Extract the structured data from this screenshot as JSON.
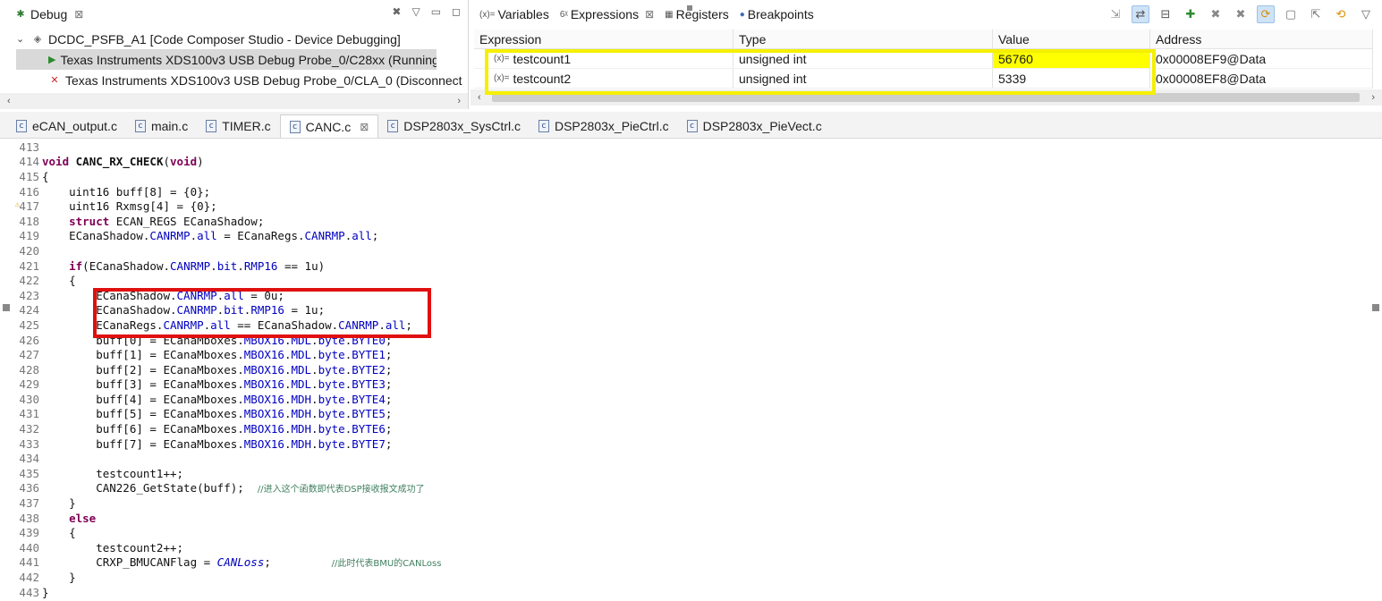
{
  "debug_view": {
    "tab_label": "Debug",
    "tree": [
      {
        "label": "DCDC_PSFB_A1 [Code Composer Studio - Device Debugging]",
        "level": 0
      },
      {
        "label": "Texas Instruments XDS100v3 USB Debug Probe_0/C28xx (Running)",
        "level": 1,
        "selected": true
      },
      {
        "label": "Texas Instruments XDS100v3 USB Debug Probe_0/CLA_0 (Disconnect",
        "level": 1
      }
    ]
  },
  "expressions_view": {
    "tabs": [
      "Variables",
      "Expressions",
      "Registers",
      "Breakpoints"
    ],
    "active_tab": "Expressions",
    "columns": [
      "Expression",
      "Type",
      "Value",
      "Address"
    ],
    "rows": [
      {
        "expression": "testcount1",
        "type": "unsigned int",
        "value": "56760",
        "address": "0x00008EF9@Data",
        "highlight": true
      },
      {
        "expression": "testcount2",
        "type": "unsigned int",
        "value": "5339",
        "address": "0x00008EF8@Data",
        "highlight": false
      }
    ]
  },
  "editor_tabs": [
    {
      "label": "eCAN_output.c"
    },
    {
      "label": "main.c"
    },
    {
      "label": "TIMER.c"
    },
    {
      "label": "CANC.c",
      "active": true
    },
    {
      "label": "DSP2803x_SysCtrl.c"
    },
    {
      "label": "DSP2803x_PieCtrl.c"
    },
    {
      "label": "DSP2803x_PieVect.c"
    }
  ],
  "code_lines": [
    {
      "n": "413",
      "html": ""
    },
    {
      "n": "414",
      "html": "<span class='kw'>void</span> <b>CANC_RX_CHECK</b>(<span class='kw'>void</span>)"
    },
    {
      "n": "415",
      "html": "{"
    },
    {
      "n": "416",
      "html": "    uint16 buff[8] = {0};"
    },
    {
      "n": "417",
      "html": "    uint16 Rxmsg[4] = {0};",
      "warn": true
    },
    {
      "n": "418",
      "html": "    <span class='kw'>struct</span> ECAN_REGS ECanaShadow;"
    },
    {
      "n": "419",
      "html": "    ECanaShadow.<span class='fld'>CANRMP</span>.<span class='fld'>all</span> = ECanaRegs.<span class='fld'>CANRMP</span>.<span class='fld'>all</span>;"
    },
    {
      "n": "420",
      "html": ""
    },
    {
      "n": "421",
      "html": "    <span class='kw'>if</span>(ECanaShadow.<span class='fld'>CANRMP</span>.<span class='fld'>bit</span>.<span class='fld'>RMP16</span> == 1u)"
    },
    {
      "n": "422",
      "html": "    {"
    },
    {
      "n": "423",
      "html": "        ECanaShadow.<span class='fld'>CANRMP</span>.<span class='fld'>all</span> = 0u;"
    },
    {
      "n": "424",
      "html": "        ECanaShadow.<span class='fld'>CANRMP</span>.<span class='fld'>bit</span>.<span class='fld'>RMP16</span> = 1u;"
    },
    {
      "n": "425",
      "html": "        ECanaRegs.<span class='fld'>CANRMP</span>.<span class='fld'>all</span> == ECanaShadow.<span class='fld'>CANRMP</span>.<span class='fld'>all</span>;"
    },
    {
      "n": "426",
      "html": "        buff[0] = ECanaMboxes.<span class='fld'>MBOX16</span>.<span class='fld'>MDL</span>.<span class='fld'>byte</span>.<span class='fld'>BYTE0</span>;"
    },
    {
      "n": "427",
      "html": "        buff[1] = ECanaMboxes.<span class='fld'>MBOX16</span>.<span class='fld'>MDL</span>.<span class='fld'>byte</span>.<span class='fld'>BYTE1</span>;"
    },
    {
      "n": "428",
      "html": "        buff[2] = ECanaMboxes.<span class='fld'>MBOX16</span>.<span class='fld'>MDL</span>.<span class='fld'>byte</span>.<span class='fld'>BYTE2</span>;"
    },
    {
      "n": "429",
      "html": "        buff[3] = ECanaMboxes.<span class='fld'>MBOX16</span>.<span class='fld'>MDL</span>.<span class='fld'>byte</span>.<span class='fld'>BYTE3</span>;"
    },
    {
      "n": "430",
      "html": "        buff[4] = ECanaMboxes.<span class='fld'>MBOX16</span>.<span class='fld'>MDH</span>.<span class='fld'>byte</span>.<span class='fld'>BYTE4</span>;"
    },
    {
      "n": "431",
      "html": "        buff[5] = ECanaMboxes.<span class='fld'>MBOX16</span>.<span class='fld'>MDH</span>.<span class='fld'>byte</span>.<span class='fld'>BYTE5</span>;"
    },
    {
      "n": "432",
      "html": "        buff[6] = ECanaMboxes.<span class='fld'>MBOX16</span>.<span class='fld'>MDH</span>.<span class='fld'>byte</span>.<span class='fld'>BYTE6</span>;"
    },
    {
      "n": "433",
      "html": "        buff[7] = ECanaMboxes.<span class='fld'>MBOX16</span>.<span class='fld'>MDH</span>.<span class='fld'>byte</span>.<span class='fld'>BYTE7</span>;"
    },
    {
      "n": "434",
      "html": ""
    },
    {
      "n": "435",
      "html": "        testcount1++;"
    },
    {
      "n": "436",
      "html": "        CAN226_GetState(buff);  <span class='cmt'>//进入这个函数即代表DSP接收报文成功了</span>"
    },
    {
      "n": "437",
      "html": "    }"
    },
    {
      "n": "438",
      "html": "    <span class='kw'>else</span>"
    },
    {
      "n": "439",
      "html": "    {"
    },
    {
      "n": "440",
      "html": "        testcount2++;"
    },
    {
      "n": "441",
      "html": "        CRXP_BMUCANFlag = <span class='itl'>CANLoss</span>;         <span class='cmt'>//此时代表BMU的CANLoss</span>"
    },
    {
      "n": "442",
      "html": "    }"
    },
    {
      "n": "443",
      "html": "}"
    }
  ],
  "colors": {
    "highlight_value": "#ffff00",
    "yellow_annotation": "#f4f000",
    "red_annotation": "#e01010"
  }
}
